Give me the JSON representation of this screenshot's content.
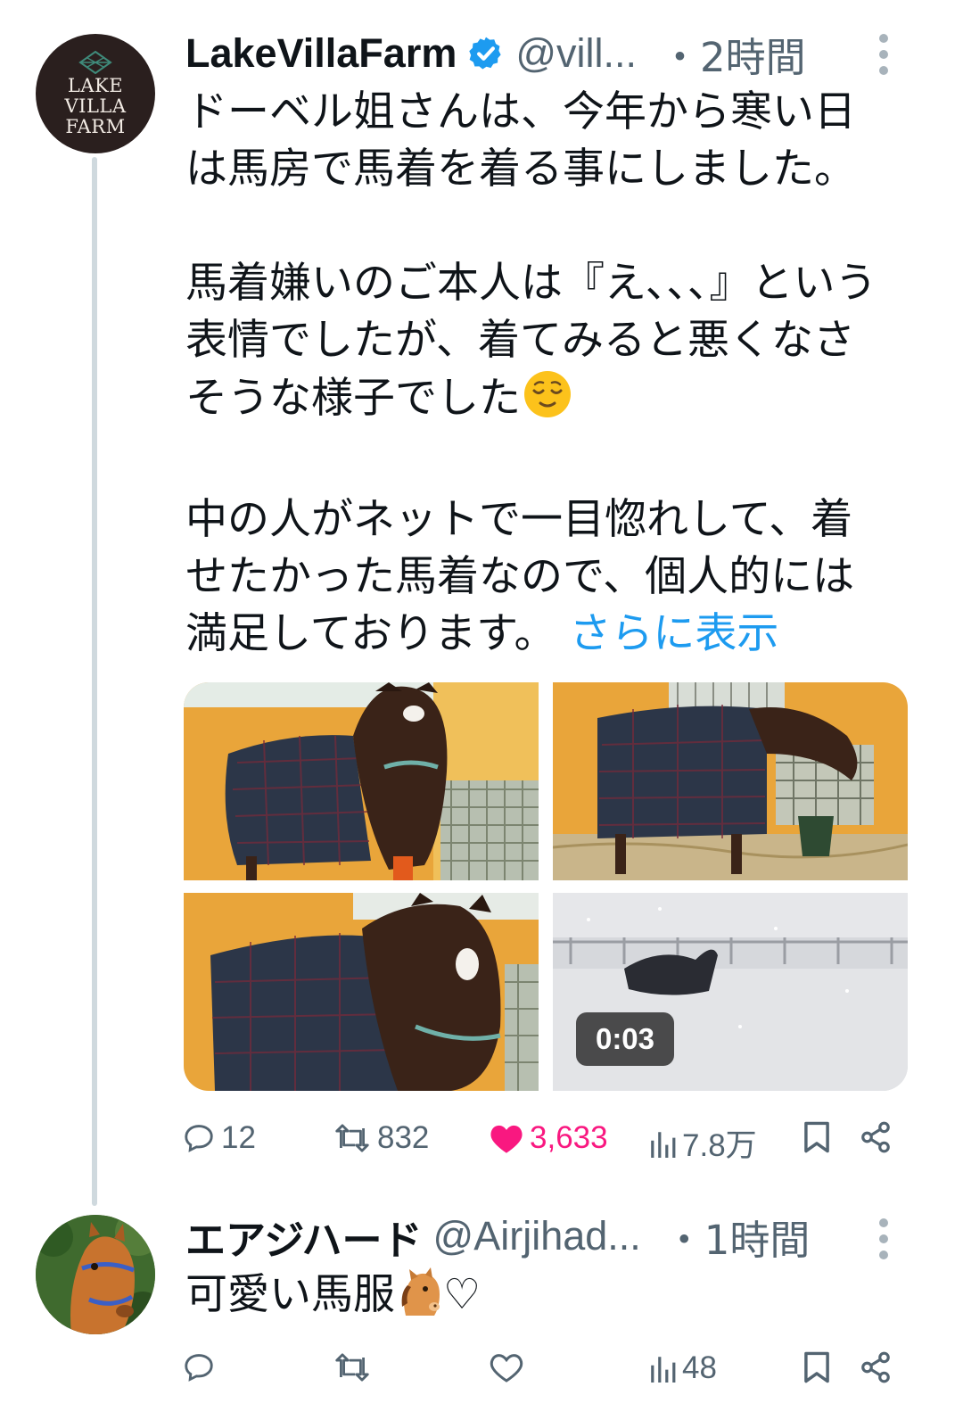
{
  "tweet": {
    "avatar_text": [
      "LAKE",
      "VILLA",
      "FARM"
    ],
    "name": "LakeVillaFarm",
    "handle": "@vill...",
    "time": "・2時間",
    "text": "ドーベル姐さんは、今年から寒い日\nは馬房で馬着を着る事にしました。\n\n馬着嫌いのご本人は『え､､､』という\n表情でしたが、着てみると悪くなさ\nそうな様子でした",
    "text_tail": "\n\n中の人がネットで一目惚れして、着\nせたかった馬着なので、個人的には\n満足しております。",
    "show_more": "さらに表示",
    "media_alts": [
      "horse in plaid blanket eating carrot",
      "horse in plaid blanket at stall",
      "horse in plaid blanket close-up",
      "horse rolling in snow video"
    ],
    "video_duration": "0:03",
    "stats": {
      "replies": "12",
      "retweets": "832",
      "likes": "3,633",
      "views": "7.8万"
    }
  },
  "reply": {
    "name": "エアジハード",
    "handle": "@Airjihad...",
    "time": "・1時間",
    "text": "可愛い馬服",
    "text_tail": "♡",
    "stats": {
      "views": "48"
    }
  },
  "colors": {
    "text": "#0f1419",
    "secondary": "#536471",
    "accent": "#1d9bf0",
    "like": "#f91880",
    "verified": "#1d9bf0"
  },
  "icons": [
    "reply-icon",
    "retweet-icon",
    "like-icon",
    "views-icon",
    "bookmark-icon",
    "share-icon",
    "verified-icon",
    "more-icon"
  ]
}
